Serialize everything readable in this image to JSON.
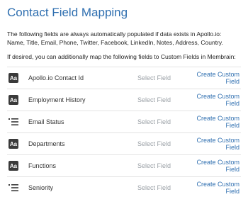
{
  "title": "Contact Field Mapping",
  "intro_line1": "The following fields are always automatically populated if data exists in Apollo.io:",
  "intro_line2": "Name, Title, Email, Phone, Twitter, Facebook, LinkedIn, Notes, Address, Country.",
  "desired_text": "If desired, you can additionally map the following fields to Custom Fields in Membrain:",
  "rows": [
    {
      "icon": "text-type-icon",
      "icon_text": "Aa",
      "label": "Apollo.io Contact Id",
      "select": "Select Field",
      "create": "Create Custom Field"
    },
    {
      "icon": "text-type-icon",
      "icon_text": "Aa",
      "label": "Employment History",
      "select": "Select Field",
      "create": "Create Custom Field"
    },
    {
      "icon": "list-type-icon",
      "icon_text": "",
      "label": "Email Status",
      "select": "Select Field",
      "create": "Create Custom Field"
    },
    {
      "icon": "text-type-icon",
      "icon_text": "Aa",
      "label": "Departments",
      "select": "Select Field",
      "create": "Create Custom Field"
    },
    {
      "icon": "text-type-icon",
      "icon_text": "Aa",
      "label": "Functions",
      "select": "Select Field",
      "create": "Create Custom Field"
    },
    {
      "icon": "list-type-icon",
      "icon_text": "",
      "label": "Seniority",
      "select": "Select Field",
      "create": "Create Custom Field"
    }
  ]
}
